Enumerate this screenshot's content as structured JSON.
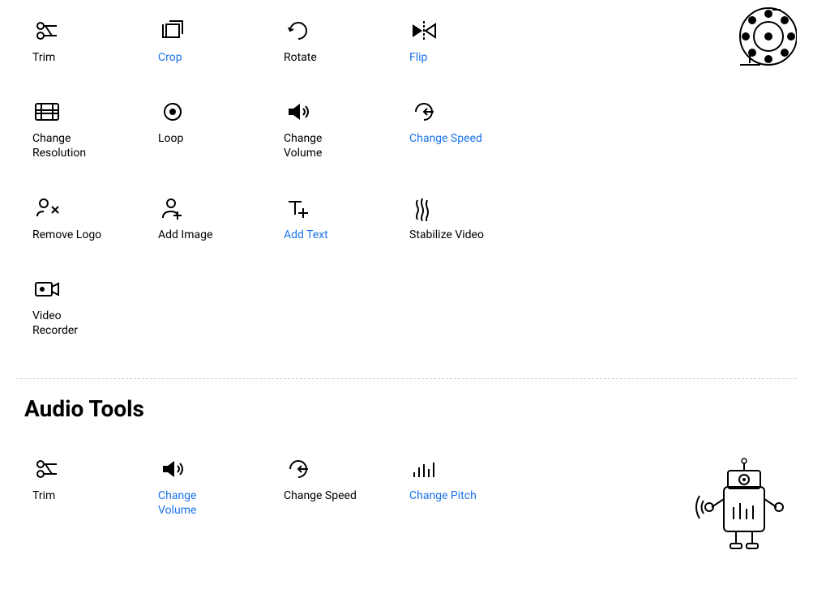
{
  "videoTools": {
    "row1": [
      {
        "id": "trim",
        "label": "Trim",
        "labelClass": "",
        "icon": "trim"
      },
      {
        "id": "crop",
        "label": "Crop",
        "labelClass": "blue",
        "icon": "crop"
      },
      {
        "id": "rotate",
        "label": "Rotate",
        "labelClass": "",
        "icon": "rotate"
      },
      {
        "id": "flip",
        "label": "Flip",
        "labelClass": "blue",
        "icon": "flip"
      }
    ],
    "row2": [
      {
        "id": "change-resolution",
        "label": "Change\nResolution",
        "labelClass": "",
        "icon": "resolution"
      },
      {
        "id": "loop",
        "label": "Loop",
        "labelClass": "",
        "icon": "loop"
      },
      {
        "id": "change-volume",
        "label": "Change\nVolume",
        "labelClass": "",
        "icon": "volume"
      },
      {
        "id": "change-speed",
        "label": "Change Speed",
        "labelClass": "blue",
        "icon": "speed"
      }
    ],
    "row3": [
      {
        "id": "remove-logo",
        "label": "Remove Logo",
        "labelClass": "",
        "icon": "remove-logo"
      },
      {
        "id": "add-image",
        "label": "Add Image",
        "labelClass": "",
        "icon": "add-image"
      },
      {
        "id": "add-text",
        "label": "Add Text",
        "labelClass": "blue",
        "icon": "add-text"
      },
      {
        "id": "stabilize-video",
        "label": "Stabilize Video",
        "labelClass": "",
        "icon": "stabilize"
      }
    ],
    "row4": [
      {
        "id": "video-recorder",
        "label": "Video\nRecorder",
        "labelClass": "",
        "icon": "recorder"
      }
    ]
  },
  "audioTools": {
    "title": "Audio Tools",
    "row1": [
      {
        "id": "audio-trim",
        "label": "Trim",
        "labelClass": "",
        "icon": "trim"
      },
      {
        "id": "audio-change-volume",
        "label": "Change\nVolume",
        "labelClass": "blue",
        "icon": "volume"
      },
      {
        "id": "audio-change-speed",
        "label": "Change Speed",
        "labelClass": "",
        "icon": "speed"
      },
      {
        "id": "audio-change-pitch",
        "label": "Change Pitch",
        "labelClass": "blue",
        "icon": "pitch"
      }
    ]
  }
}
